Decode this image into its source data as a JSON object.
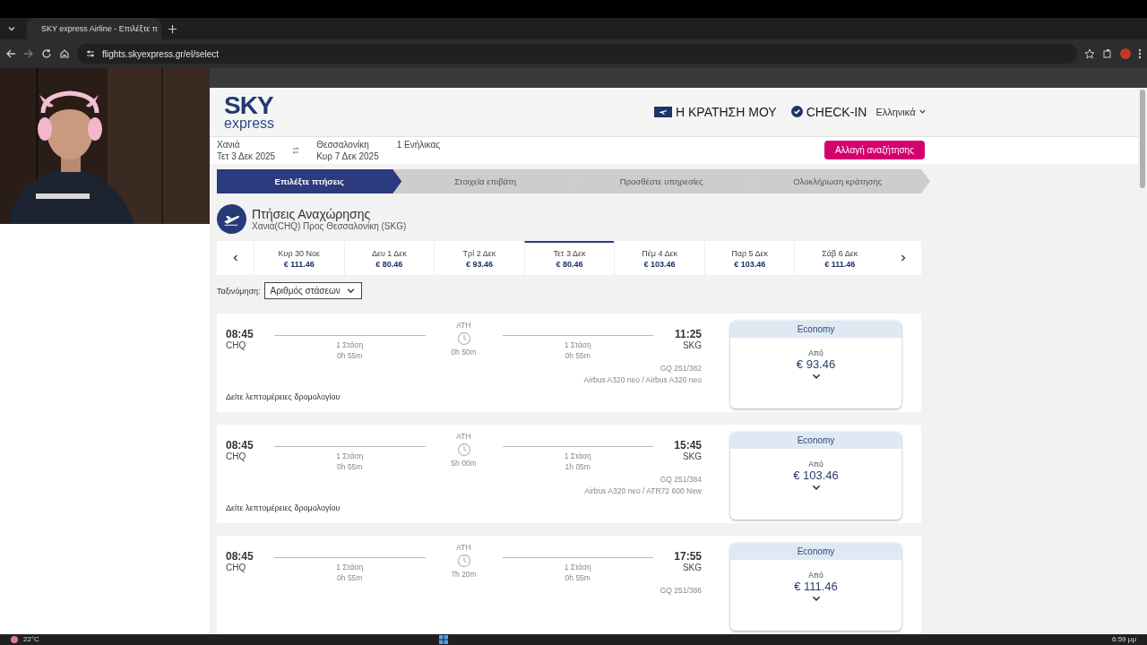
{
  "browser": {
    "tab_title": "SKY express Airline - Επιλέξτε π",
    "url": "flights.skyexpress.gr/el/select"
  },
  "site": {
    "logo_top": "SKY",
    "logo_bottom": "express",
    "nav": [
      {
        "kind": "booking",
        "label": "Η ΚΡΑΤΗΣΗ ΜΟΥ"
      },
      {
        "kind": "checkin",
        "label": "CHECK-IN"
      }
    ],
    "language": "Ελληνικά"
  },
  "search": {
    "origin": {
      "city": "Χανιά",
      "date": "Τετ 3 Δεκ 2025"
    },
    "destination": {
      "city": "Θεσσαλονίκη",
      "date": "Κυρ 7 Δεκ 2025"
    },
    "passengers": "1 Ενήλικας",
    "button": "Αλλαγή αναζήτησης"
  },
  "steps": [
    {
      "label": "Επιλέξτε πτήσεις",
      "selected": true
    },
    {
      "label": "Στοιχεία επιβάτη",
      "selected": false
    },
    {
      "label": "Προσθέστε υπηρεσίες",
      "selected": false
    },
    {
      "label": "Ολοκλήρωση κράτησης",
      "selected": false
    }
  ],
  "section": {
    "title": "Πτήσεις Αναχώρησης",
    "subtitle": "Χανιά(CHQ) Προς Θεσσαλονίκη (SKG)"
  },
  "dates": [
    {
      "day": "Κυρ 30 Νοε",
      "price": "€ 111.46",
      "selected": false
    },
    {
      "day": "Δευ 1 Δεκ",
      "price": "€ 80.46",
      "selected": false
    },
    {
      "day": "Τρί 2 Δεκ",
      "price": "€ 93.46",
      "selected": false
    },
    {
      "day": "Τετ 3 Δεκ",
      "price": "€ 80.46",
      "selected": true
    },
    {
      "day": "Πέμ 4 Δεκ",
      "price": "€ 103.46",
      "selected": false
    },
    {
      "day": "Παρ 5 Δεκ",
      "price": "€ 103.46",
      "selected": false
    },
    {
      "day": "Σάβ 6 Δεκ",
      "price": "€ 111.46",
      "selected": false
    }
  ],
  "sort": {
    "label": "Ταξινόμηση:",
    "value": "Αριθμός στάσεων"
  },
  "flights": [
    {
      "dep_time": "08:45",
      "dep_code": "CHQ",
      "leg1": {
        "stops": "1 Στάση",
        "duration": "0h 55m"
      },
      "via": "ATH",
      "layover": "0h 50m",
      "leg2": {
        "stops": "1 Στάση",
        "duration": "0h 55m"
      },
      "arr_time": "11:25",
      "arr_code": "SKG",
      "flight_no": "GQ 251/382",
      "aircraft": "Airbus A320 neo / Airbus A320 neo",
      "details_link": "Δείτε λεπτομέρειες δρομολογίου",
      "fare": {
        "class": "Economy",
        "from": "Από",
        "price": "€ 93.46"
      }
    },
    {
      "dep_time": "08:45",
      "dep_code": "CHQ",
      "leg1": {
        "stops": "1 Στάση",
        "duration": "0h 55m"
      },
      "via": "ATH",
      "layover": "5h 00m",
      "leg2": {
        "stops": "1 Στάση",
        "duration": "1h 05m"
      },
      "arr_time": "15:45",
      "arr_code": "SKG",
      "flight_no": "GQ 251/384",
      "aircraft": "Airbus A320 neo / ATR72 600 New",
      "details_link": "Δείτε λεπτομέρειες δρομολογίου",
      "fare": {
        "class": "Economy",
        "from": "Από",
        "price": "€ 103.46"
      }
    },
    {
      "dep_time": "08:45",
      "dep_code": "CHQ",
      "leg1": {
        "stops": "1 Στάση",
        "duration": "0h 55m"
      },
      "via": "ATH",
      "layover": "7h 20m",
      "leg2": {
        "stops": "1 Στάση",
        "duration": "0h 55m"
      },
      "arr_time": "17:55",
      "arr_code": "SKG",
      "flight_no": "GQ 251/386",
      "fare": {
        "class": "Economy",
        "from": "Από",
        "price": "€ 111.46"
      }
    }
  ],
  "taskbar": {
    "weather": "22°C",
    "time": "6:59 μμ"
  }
}
